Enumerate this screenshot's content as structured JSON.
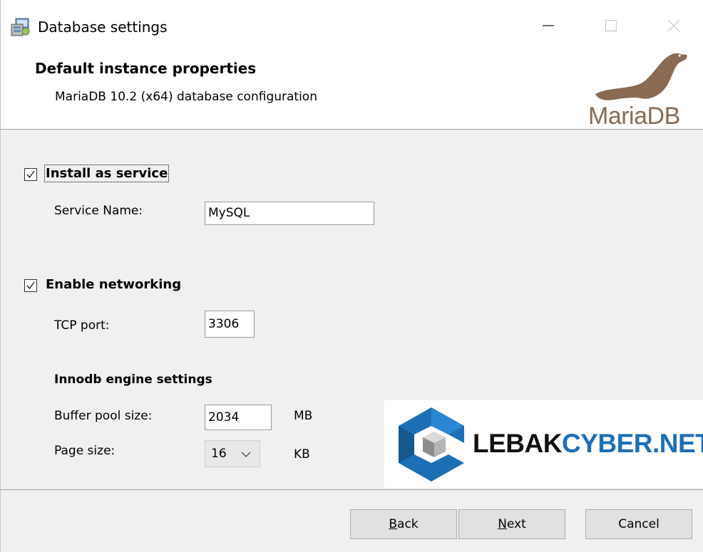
{
  "window": {
    "title": "Database settings",
    "icon": "installer-icon",
    "controls": [
      "minimize-icon",
      "maximize-icon",
      "close-icon"
    ]
  },
  "header": {
    "title": "Default instance properties",
    "subtitle": "MariaDB 10.2 (x64) database configuration",
    "logo_text": "MariaDB"
  },
  "service": {
    "checkbox_label": "Install as service",
    "checked": true,
    "name_label": "Service Name:",
    "name_value": "MySQL"
  },
  "networking": {
    "checkbox_label": "Enable networking",
    "checked": true,
    "port_label": "TCP port:",
    "port_value": "3306"
  },
  "innodb": {
    "heading": "Innodb engine settings",
    "buffer_label": "Buffer pool size:",
    "buffer_value": "2034",
    "buffer_unit": "MB",
    "page_label": "Page size:",
    "page_value": "16",
    "page_unit": "KB"
  },
  "watermark": {
    "text_part1": "LEBAK",
    "text_part2": "CYBER.NET"
  },
  "buttons": {
    "back_prefix": "",
    "back_mnemonic": "B",
    "back_rest": "ack",
    "next_prefix": "",
    "next_mnemonic": "N",
    "next_rest": "ext",
    "cancel": "Cancel"
  },
  "colors": {
    "window_bg": "#f0f0f0",
    "header_bg": "#ffffff",
    "mariadb_brown": "#8a6a52",
    "watermark_blue": "#1d6fb5"
  }
}
